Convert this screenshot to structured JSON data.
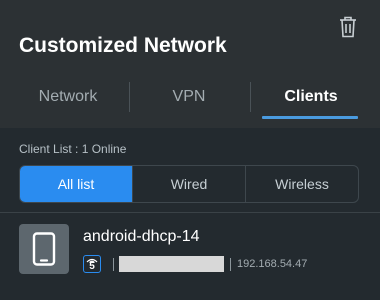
{
  "panel": {
    "title": "Customized Network",
    "delete_icon": "trash-icon"
  },
  "tabs": [
    {
      "label": "Network",
      "active": false
    },
    {
      "label": "VPN",
      "active": false
    },
    {
      "label": "Clients",
      "active": true
    }
  ],
  "client_list": {
    "summary": "Client List : 1 Online",
    "filters": [
      {
        "label": "All list",
        "active": true
      },
      {
        "label": "Wired",
        "active": false
      },
      {
        "label": "Wireless",
        "active": false
      }
    ],
    "clients": [
      {
        "name": "android-dhcp-14",
        "device_icon": "smartphone-icon",
        "connection_icon": "wifi-icon",
        "band": "5",
        "mac_redacted": true,
        "ip": "192.168.54.47"
      }
    ]
  },
  "colors": {
    "panel_bg": "#2c3134",
    "list_bg": "#232a2f",
    "accent": "#2a8cf0",
    "tab_underline": "#4a9bdf",
    "text_primary": "#ffffff",
    "text_muted": "#a3acb1"
  }
}
